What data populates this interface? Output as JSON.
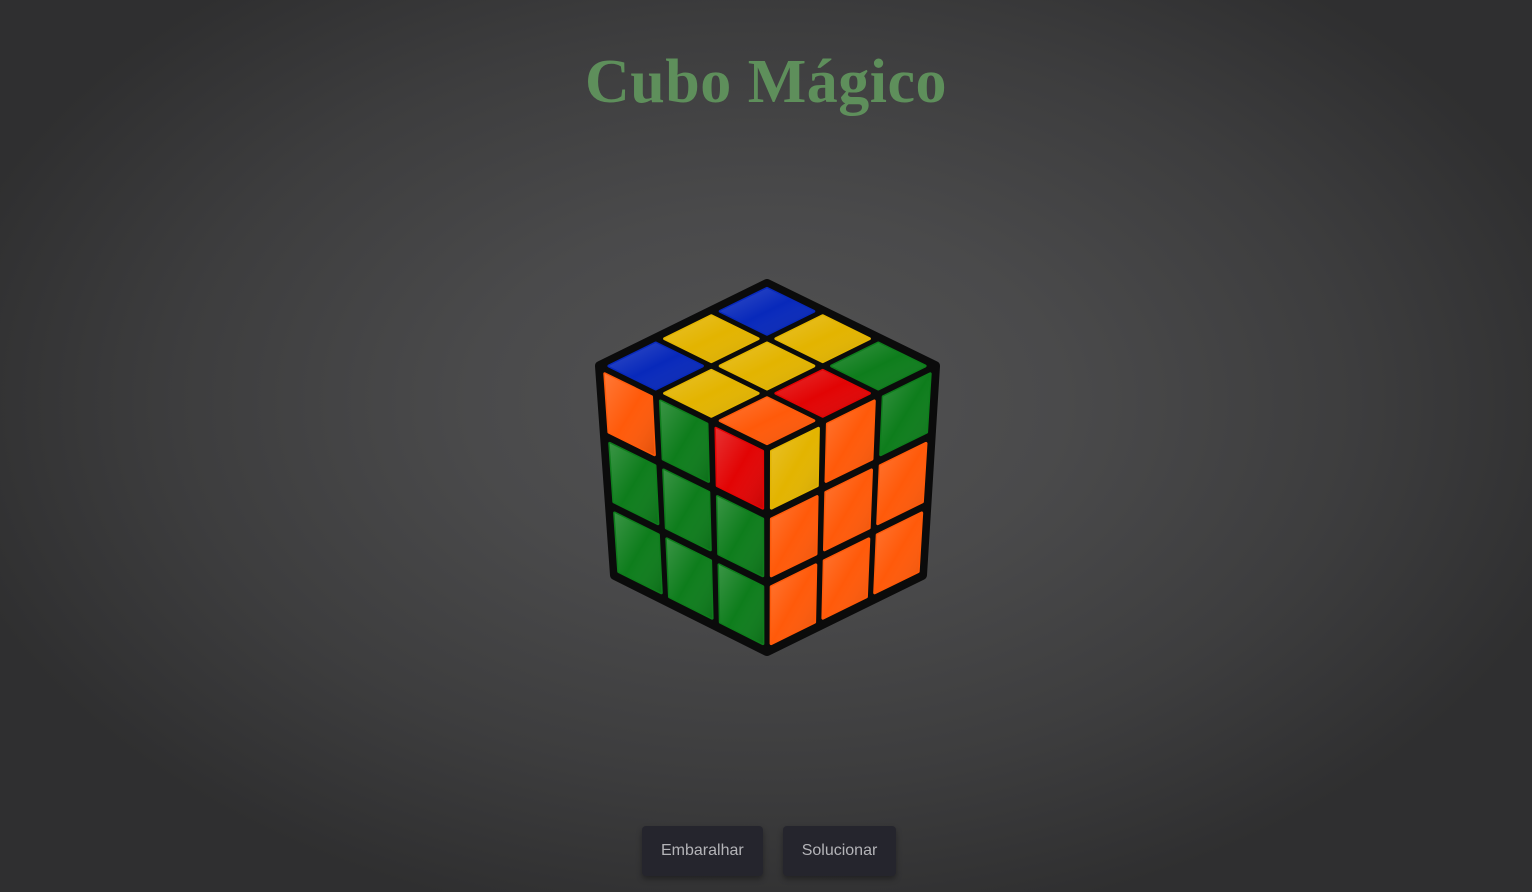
{
  "title": "Cubo Mágico",
  "colors": {
    "title": "#5e8f5b",
    "stickers": {
      "O": "#ff5a0a",
      "Y": "#e3b400",
      "B": "#0829bb",
      "R": "#e20404",
      "G": "#0e7d1c"
    },
    "button_bg": "#25252d",
    "button_text": "#b4b4b8"
  },
  "cube": {
    "top": [
      [
        "O",
        "R",
        "G"
      ],
      [
        "Y",
        "Y",
        "Y"
      ],
      [
        "B",
        "Y",
        "B"
      ]
    ],
    "left": [
      [
        "O",
        "G",
        "R"
      ],
      [
        "G",
        "G",
        "G"
      ],
      [
        "G",
        "G",
        "G"
      ]
    ],
    "right": [
      [
        "Y",
        "O",
        "G"
      ],
      [
        "O",
        "O",
        "O"
      ],
      [
        "O",
        "O",
        "O"
      ]
    ]
  },
  "buttons": {
    "scramble": "Embaralhar",
    "solve": "Solucionar"
  }
}
